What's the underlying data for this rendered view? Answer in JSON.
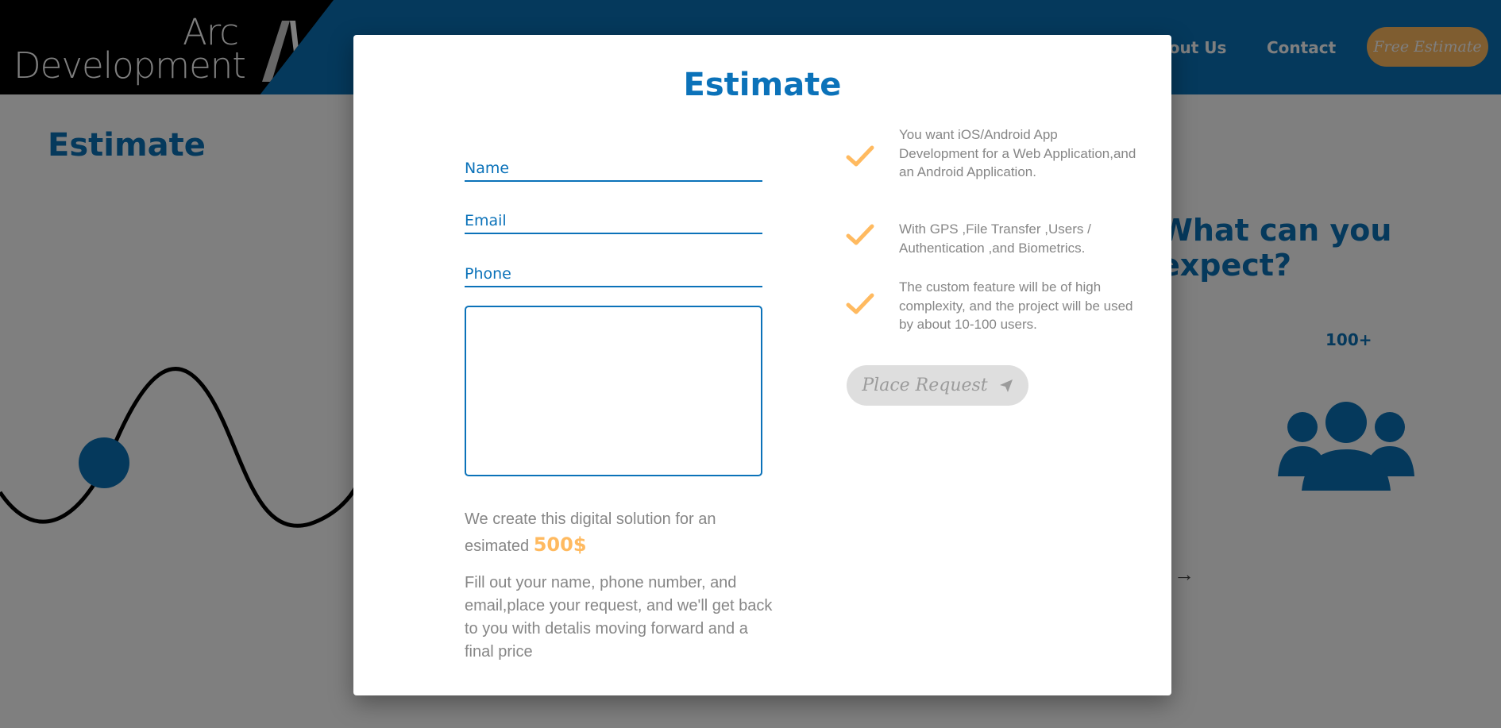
{
  "header": {
    "logo_line1": "Arc",
    "logo_line2": "Development",
    "nav": [
      {
        "label": "About Us"
      },
      {
        "label": "Contact"
      }
    ],
    "cta_label": "Free Estimate"
  },
  "background": {
    "title": "Estimate",
    "question": "What can you expect?",
    "count": "100+"
  },
  "modal": {
    "title": "Estimate",
    "fields": {
      "name": "Name",
      "email": "Email",
      "phone": "Phone"
    },
    "message_value": "",
    "price_prefix": "We create this digital solution for an esimated",
    "price": "500$",
    "fill_out": "Fill out your name, phone number, and email,place your request, and we'll get back to you with detalis moving forward and a final price",
    "checklist": [
      "You want iOS/Android App Development for a Web Application,and an Android Application.",
      "With GPS ,File Transfer ,Users / Authentication ,and Biometrics.",
      "The custom feature will be of high complexity, and the project will be used by about 10-100 users."
    ],
    "place_request_label": "Place Request"
  },
  "colors": {
    "primary": "#0b72b9",
    "accent": "#ffba60",
    "muted_text": "#868686",
    "disabled_button": "#dedede"
  }
}
